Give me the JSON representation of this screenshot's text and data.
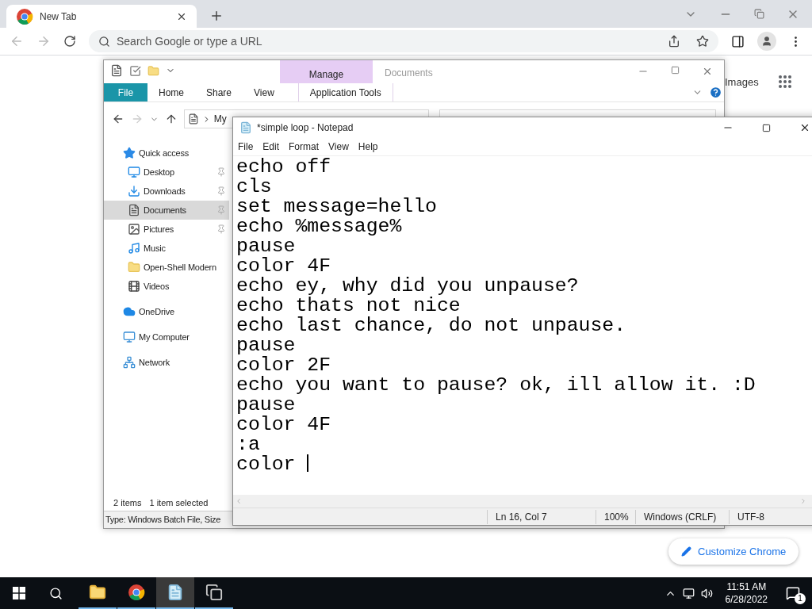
{
  "browser": {
    "tab_title": "New Tab",
    "omnibox": {
      "placeholder": "Search Google or type a URL"
    },
    "links": [
      "Images"
    ],
    "customize_button": "Customize Chrome"
  },
  "explorer": {
    "context_tab": "Manage",
    "title": "Documents",
    "ribbon_tabs": [
      {
        "label": "File",
        "kind": "file"
      },
      {
        "label": "Home",
        "kind": "plain"
      },
      {
        "label": "Share",
        "kind": "plain"
      },
      {
        "label": "View",
        "kind": "plain"
      },
      {
        "label": "Application Tools",
        "kind": "contextual"
      }
    ],
    "address": "My",
    "nav": [
      {
        "label": "Quick access",
        "selected": false,
        "children": [
          {
            "label": "Desktop",
            "pinned": true,
            "selected": false
          },
          {
            "label": "Downloads",
            "pinned": true,
            "selected": false
          },
          {
            "label": "Documents",
            "pinned": true,
            "selected": true
          },
          {
            "label": "Pictures",
            "pinned": true,
            "selected": false
          },
          {
            "label": "Music",
            "pinned": false,
            "selected": false
          },
          {
            "label": "Open-Shell Modern",
            "pinned": false,
            "selected": false
          },
          {
            "label": "Videos",
            "pinned": false,
            "selected": false
          }
        ]
      },
      {
        "label": "OneDrive",
        "selected": false
      },
      {
        "label": "My Computer",
        "selected": false
      },
      {
        "label": "Network",
        "selected": false
      }
    ],
    "status": [
      "2 items",
      "1 item selected"
    ],
    "details": "Type: Windows Batch File, Size"
  },
  "notepad": {
    "title": "*simple loop - Notepad",
    "menu": [
      "File",
      "Edit",
      "Format",
      "View",
      "Help"
    ],
    "lines": [
      "echo off",
      "cls",
      "set message=hello",
      "echo %message%",
      "pause",
      "color 4F",
      "echo ey, why did you unpause?",
      "echo thats not nice",
      "echo last chance, do not unpause.",
      "pause",
      "color 2F",
      "echo you want to pause? ok, ill allow it. :D",
      "pause",
      "color 4F",
      ":a",
      "color "
    ],
    "status": [
      "Ln 16, Col 7",
      "100%",
      "Windows (CRLF)",
      "UTF-8"
    ]
  },
  "taskbar": {
    "apps": [
      {
        "selected": false
      },
      {
        "selected": false
      },
      {
        "selected": true
      },
      {
        "selected": false
      }
    ],
    "time": "11:51 AM",
    "date": "6/28/2022",
    "notifications": "1"
  }
}
